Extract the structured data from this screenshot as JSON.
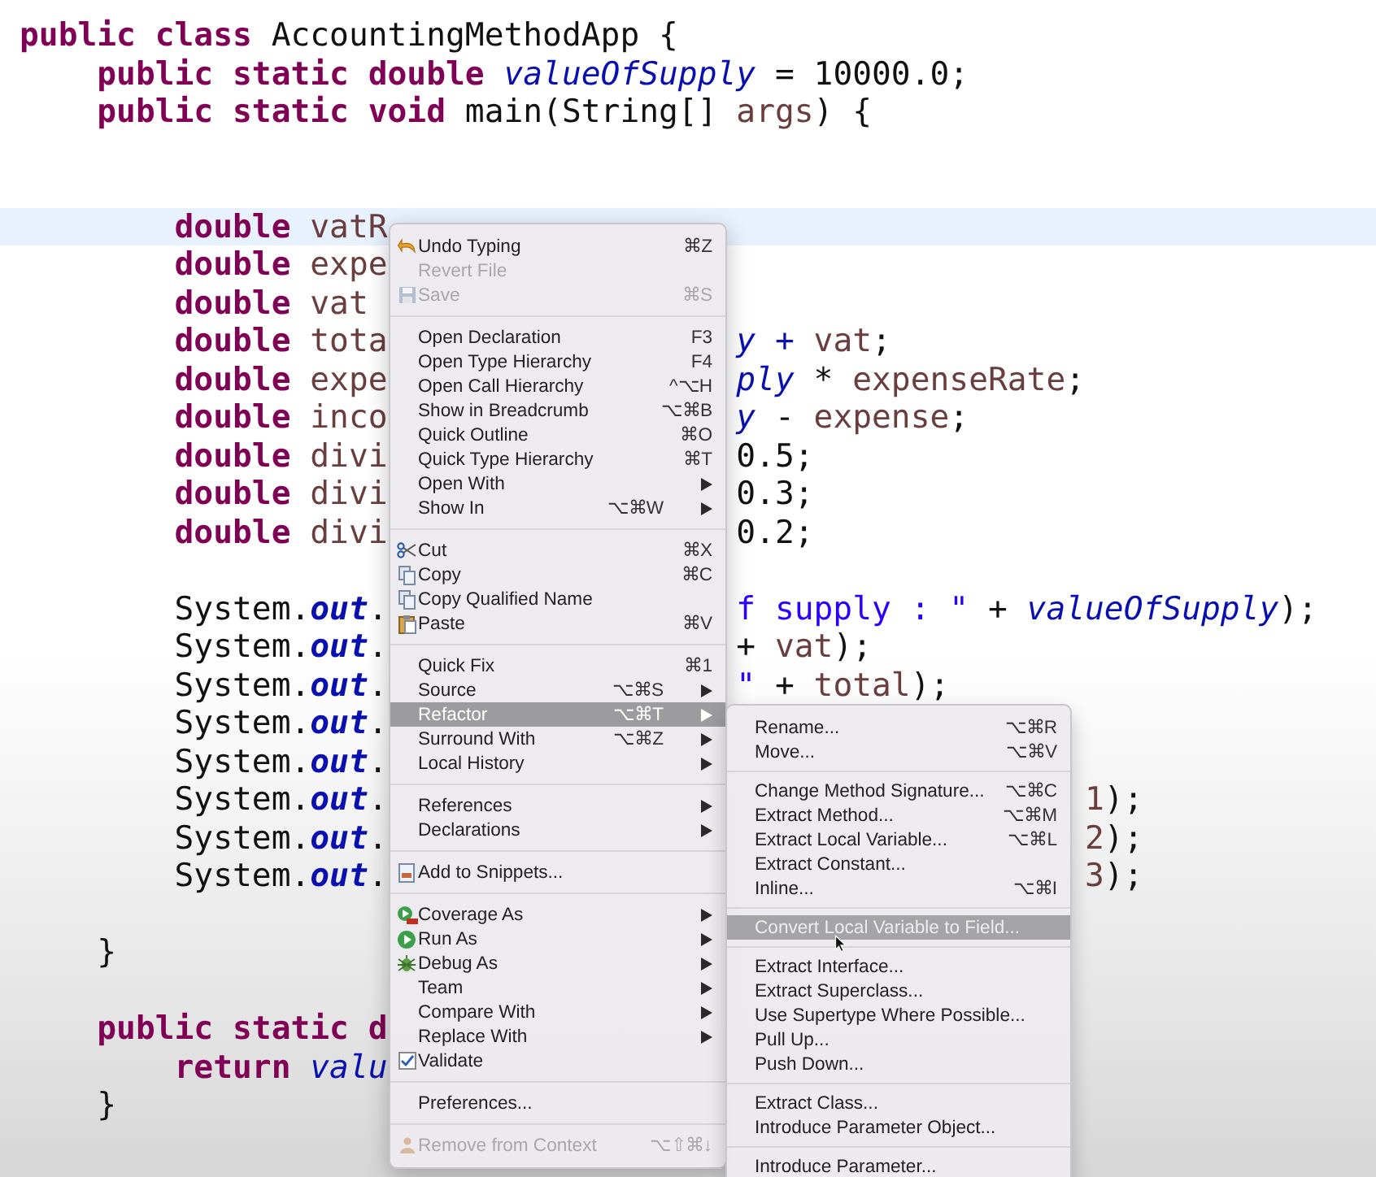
{
  "code_lines": [
    {
      "current": false,
      "left": [
        {
          "text": "public class ",
          "kind": "kw"
        },
        {
          "text": "AccountingMethodApp {",
          "kind": "plain"
        }
      ]
    },
    {
      "current": false,
      "left": [
        {
          "text": "    public static double ",
          "kind": "kw"
        },
        {
          "text": "valueOfSupply",
          "kind": "field"
        },
        {
          "text": " = 10000.0;",
          "kind": "plain"
        }
      ]
    },
    {
      "current": false,
      "left": [
        {
          "text": "    public static void ",
          "kind": "kw"
        },
        {
          "text": "main(String[] ",
          "kind": "plain"
        },
        {
          "text": "args",
          "kind": "var"
        },
        {
          "text": ") {",
          "kind": "plain"
        }
      ]
    },
    {
      "current": false
    },
    {
      "current": false
    },
    {
      "current": true,
      "left": [
        {
          "text": "        double ",
          "kind": "kw"
        },
        {
          "text": "vatR",
          "kind": "var"
        }
      ]
    },
    {
      "current": false,
      "left": [
        {
          "text": "        double ",
          "kind": "kw"
        },
        {
          "text": "expe",
          "kind": "var"
        }
      ]
    },
    {
      "current": false,
      "left": [
        {
          "text": "        double ",
          "kind": "kw"
        },
        {
          "text": "vat",
          "kind": "var"
        }
      ]
    },
    {
      "current": false,
      "left": [
        {
          "text": "        double ",
          "kind": "kw"
        },
        {
          "text": "tota",
          "kind": "var"
        }
      ],
      "kind": "behind_menu",
      "right": [
        {
          "text": "y + ",
          "kind": "field"
        },
        {
          "text": "vat",
          "kind": "var"
        },
        {
          "text": ";",
          "kind": "plain"
        }
      ]
    },
    {
      "current": false,
      "left": [
        {
          "text": "        double ",
          "kind": "kw"
        },
        {
          "text": "expe",
          "kind": "var"
        }
      ],
      "kind": "behind_menu",
      "right": [
        {
          "text": "ply",
          "kind": "field"
        },
        {
          "text": " * ",
          "kind": "plain"
        },
        {
          "text": "expenseRate",
          "kind": "var"
        },
        {
          "text": ";",
          "kind": "plain"
        }
      ]
    },
    {
      "current": false,
      "left": [
        {
          "text": "        double ",
          "kind": "kw"
        },
        {
          "text": "inco",
          "kind": "var"
        }
      ],
      "kind": "behind_menu",
      "right": [
        {
          "text": "y",
          "kind": "field"
        },
        {
          "text": " - ",
          "kind": "plain"
        },
        {
          "text": "expense",
          "kind": "var"
        },
        {
          "text": ";",
          "kind": "plain"
        }
      ]
    },
    {
      "current": false,
      "left": [
        {
          "text": "        double ",
          "kind": "kw"
        },
        {
          "text": "divi",
          "kind": "var"
        }
      ],
      "kind": "behind_menu",
      "right": [
        {
          "text": "0.5;",
          "kind": "plain"
        }
      ]
    },
    {
      "current": false,
      "left": [
        {
          "text": "        double ",
          "kind": "kw"
        },
        {
          "text": "divi",
          "kind": "var"
        }
      ],
      "kind": "behind_menu",
      "right": [
        {
          "text": "0.3;",
          "kind": "plain"
        }
      ]
    },
    {
      "current": false,
      "left": [
        {
          "text": "        double ",
          "kind": "kw"
        },
        {
          "text": "divi",
          "kind": "var"
        }
      ],
      "kind": "behind_menu",
      "right": [
        {
          "text": "0.2;",
          "kind": "plain"
        }
      ]
    },
    {
      "current": false
    },
    {
      "current": false,
      "left": [
        {
          "text": "        System.",
          "kind": "plain"
        },
        {
          "text": "out",
          "kind": "static"
        },
        {
          "text": ".",
          "kind": "plain"
        }
      ],
      "kind": "behind_menu",
      "right": [
        {
          "text": "f supply : \"",
          "kind": "string"
        },
        {
          "text": " + ",
          "kind": "plain"
        },
        {
          "text": "valueOfSupply",
          "kind": "field"
        },
        {
          "text": ");",
          "kind": "plain"
        }
      ]
    },
    {
      "current": false,
      "left": [
        {
          "text": "        System.",
          "kind": "plain"
        },
        {
          "text": "out",
          "kind": "static"
        },
        {
          "text": ".",
          "kind": "plain"
        }
      ],
      "kind": "behind_menu",
      "right": [
        {
          "text": "+ ",
          "kind": "plain"
        },
        {
          "text": "vat",
          "kind": "var"
        },
        {
          "text": ");",
          "kind": "plain"
        }
      ]
    },
    {
      "current": false,
      "left": [
        {
          "text": "        System.",
          "kind": "plain"
        },
        {
          "text": "out",
          "kind": "static"
        },
        {
          "text": ".",
          "kind": "plain"
        }
      ],
      "kind": "behind_menu",
      "right": [
        {
          "text": "\"",
          "kind": "string"
        },
        {
          "text": " + ",
          "kind": "plain"
        },
        {
          "text": "total",
          "kind": "var"
        },
        {
          "text": ");",
          "kind": "plain"
        }
      ]
    },
    {
      "current": false,
      "left": [
        {
          "text": "        System.",
          "kind": "plain"
        },
        {
          "text": "out",
          "kind": "static"
        },
        {
          "text": ".",
          "kind": "plain"
        }
      ]
    },
    {
      "current": false,
      "left": [
        {
          "text": "        System.",
          "kind": "plain"
        },
        {
          "text": "out",
          "kind": "static"
        },
        {
          "text": ".",
          "kind": "plain"
        }
      ]
    },
    {
      "current": false,
      "left": [
        {
          "text": "        System.",
          "kind": "plain"
        },
        {
          "text": "out",
          "kind": "static"
        },
        {
          "text": ".",
          "kind": "plain"
        }
      ],
      "kind": "behind_submenu",
      "right": [
        {
          "text": "1",
          "kind": "var"
        },
        {
          "text": ");",
          "kind": "plain"
        }
      ]
    },
    {
      "current": false,
      "left": [
        {
          "text": "        System.",
          "kind": "plain"
        },
        {
          "text": "out",
          "kind": "static"
        },
        {
          "text": ".",
          "kind": "plain"
        }
      ],
      "kind": "behind_submenu",
      "right": [
        {
          "text": "2",
          "kind": "var"
        },
        {
          "text": ");",
          "kind": "plain"
        }
      ]
    },
    {
      "current": false,
      "left": [
        {
          "text": "        System.",
          "kind": "plain"
        },
        {
          "text": "out",
          "kind": "static"
        },
        {
          "text": ".",
          "kind": "plain"
        }
      ],
      "kind": "behind_submenu",
      "right": [
        {
          "text": "3",
          "kind": "var"
        },
        {
          "text": ");",
          "kind": "plain"
        }
      ]
    },
    {
      "current": false
    },
    {
      "current": false,
      "left": [
        {
          "text": "    }",
          "kind": "plain"
        }
      ]
    },
    {
      "current": false
    },
    {
      "current": false,
      "left": [
        {
          "text": "    public static d",
          "kind": "kw"
        }
      ]
    },
    {
      "current": false,
      "left": [
        {
          "text": "        return ",
          "kind": "kw"
        },
        {
          "text": "valu",
          "kind": "field"
        }
      ]
    },
    {
      "current": false,
      "left": [
        {
          "text": "    }",
          "kind": "plain"
        }
      ]
    }
  ],
  "context_menu": [
    {
      "kind": "item",
      "label": "Undo Typing",
      "shortcut": "⌘Z",
      "disabled": false,
      "selected": false,
      "submenu": false
    },
    {
      "kind": "item",
      "label": "Revert File",
      "disabled": true,
      "selected": false,
      "submenu": false
    },
    {
      "kind": "item",
      "label": "Save",
      "shortcut": "⌘S",
      "disabled": true,
      "selected": false,
      "submenu": false
    },
    {
      "kind": "separator"
    },
    {
      "kind": "item",
      "label": "Open Declaration",
      "shortcut": "F3",
      "disabled": false,
      "selected": false,
      "submenu": false
    },
    {
      "kind": "item",
      "label": "Open Type Hierarchy",
      "shortcut": "F4",
      "disabled": false,
      "selected": false,
      "submenu": false
    },
    {
      "kind": "item",
      "label": "Open Call Hierarchy",
      "shortcut": "^⌥H",
      "disabled": false,
      "selected": false,
      "submenu": false
    },
    {
      "kind": "item",
      "label": "Show in Breadcrumb",
      "shortcut": "⌥⌘B",
      "disabled": false,
      "selected": false,
      "submenu": false
    },
    {
      "kind": "item",
      "label": "Quick Outline",
      "shortcut": "⌘O",
      "disabled": false,
      "selected": false,
      "submenu": false
    },
    {
      "kind": "item",
      "label": "Quick Type Hierarchy",
      "shortcut": "⌘T",
      "disabled": false,
      "selected": false,
      "submenu": false
    },
    {
      "kind": "item",
      "label": "Open With",
      "disabled": false,
      "selected": false,
      "submenu": true
    },
    {
      "kind": "item",
      "label": "Show In",
      "shortcut": "⌥⌘W",
      "disabled": false,
      "selected": false,
      "submenu": true
    },
    {
      "kind": "separator"
    },
    {
      "kind": "item",
      "label": "Cut",
      "shortcut": "⌘X",
      "disabled": false,
      "selected": false,
      "submenu": false
    },
    {
      "kind": "item",
      "label": "Copy",
      "shortcut": "⌘C",
      "disabled": false,
      "selected": false,
      "submenu": false
    },
    {
      "kind": "item",
      "label": "Copy Qualified Name",
      "disabled": false,
      "selected": false,
      "submenu": false
    },
    {
      "kind": "item",
      "label": "Paste",
      "shortcut": "⌘V",
      "disabled": false,
      "selected": false,
      "submenu": false
    },
    {
      "kind": "separator"
    },
    {
      "kind": "item",
      "label": "Quick Fix",
      "shortcut": "⌘1",
      "disabled": false,
      "selected": false,
      "submenu": false
    },
    {
      "kind": "item",
      "label": "Source",
      "shortcut": "⌥⌘S",
      "disabled": false,
      "selected": false,
      "submenu": true
    },
    {
      "kind": "item",
      "label": "Refactor",
      "shortcut": "⌥⌘T",
      "disabled": false,
      "selected": true,
      "submenu": true
    },
    {
      "kind": "item",
      "label": "Surround With",
      "shortcut": "⌥⌘Z",
      "disabled": false,
      "selected": false,
      "submenu": true
    },
    {
      "kind": "item",
      "label": "Local History",
      "disabled": false,
      "selected": false,
      "submenu": true
    },
    {
      "kind": "separator"
    },
    {
      "kind": "item",
      "label": "References",
      "disabled": false,
      "selected": false,
      "submenu": true
    },
    {
      "kind": "item",
      "label": "Declarations",
      "disabled": false,
      "selected": false,
      "submenu": true
    },
    {
      "kind": "separator"
    },
    {
      "kind": "item",
      "label": "Add to Snippets...",
      "disabled": false,
      "selected": false,
      "submenu": false
    },
    {
      "kind": "separator"
    },
    {
      "kind": "item",
      "label": "Coverage As",
      "disabled": false,
      "selected": false,
      "submenu": true
    },
    {
      "kind": "item",
      "label": "Run As",
      "disabled": false,
      "selected": false,
      "submenu": true
    },
    {
      "kind": "item",
      "label": "Debug As",
      "disabled": false,
      "selected": false,
      "submenu": true
    },
    {
      "kind": "item",
      "label": "Team",
      "disabled": false,
      "selected": false,
      "submenu": true
    },
    {
      "kind": "item",
      "label": "Compare With",
      "disabled": false,
      "selected": false,
      "submenu": true
    },
    {
      "kind": "item",
      "label": "Replace With",
      "disabled": false,
      "selected": false,
      "submenu": true
    },
    {
      "kind": "check",
      "label": "Validate",
      "checked": true,
      "disabled": false,
      "selected": false,
      "submenu": false
    },
    {
      "kind": "separator"
    },
    {
      "kind": "item",
      "label": "Preferences...",
      "disabled": false,
      "selected": false,
      "submenu": false
    },
    {
      "kind": "separator"
    },
    {
      "kind": "item",
      "label": "Remove from Context",
      "shortcut": "⌥⇧⌘↓",
      "disabled": true,
      "selected": false,
      "submenu": false
    }
  ],
  "refactor_submenu": [
    {
      "kind": "item",
      "label": "Rename...",
      "shortcut": "⌥⌘R",
      "selected": false
    },
    {
      "kind": "item",
      "label": "Move...",
      "shortcut": "⌥⌘V",
      "selected": false
    },
    {
      "kind": "separator"
    },
    {
      "kind": "item",
      "label": "Change Method Signature...",
      "shortcut": "⌥⌘C",
      "selected": false
    },
    {
      "kind": "item",
      "label": "Extract Method...",
      "shortcut": "⌥⌘M",
      "selected": false
    },
    {
      "kind": "item",
      "label": "Extract Local Variable...",
      "shortcut": "⌥⌘L",
      "selected": false
    },
    {
      "kind": "item",
      "label": "Extract Constant...",
      "selected": false
    },
    {
      "kind": "item",
      "label": "Inline...",
      "shortcut": "⌥⌘I",
      "selected": false
    },
    {
      "kind": "separator"
    },
    {
      "kind": "item",
      "label": "Convert Local Variable to Field...",
      "selected": true
    },
    {
      "kind": "separator"
    },
    {
      "kind": "item",
      "label": "Extract Interface...",
      "selected": false
    },
    {
      "kind": "item",
      "label": "Extract Superclass...",
      "selected": false
    },
    {
      "kind": "item",
      "label": "Use Supertype Where Possible...",
      "selected": false
    },
    {
      "kind": "item",
      "label": "Pull Up...",
      "selected": false
    },
    {
      "kind": "item",
      "label": "Push Down...",
      "selected": false
    },
    {
      "kind": "separator"
    },
    {
      "kind": "item",
      "label": "Extract Class...",
      "selected": false
    },
    {
      "kind": "item",
      "label": "Introduce Parameter Object...",
      "selected": false
    },
    {
      "kind": "separator"
    },
    {
      "kind": "item",
      "label": "Introduce Parameter...",
      "selected": false
    }
  ]
}
